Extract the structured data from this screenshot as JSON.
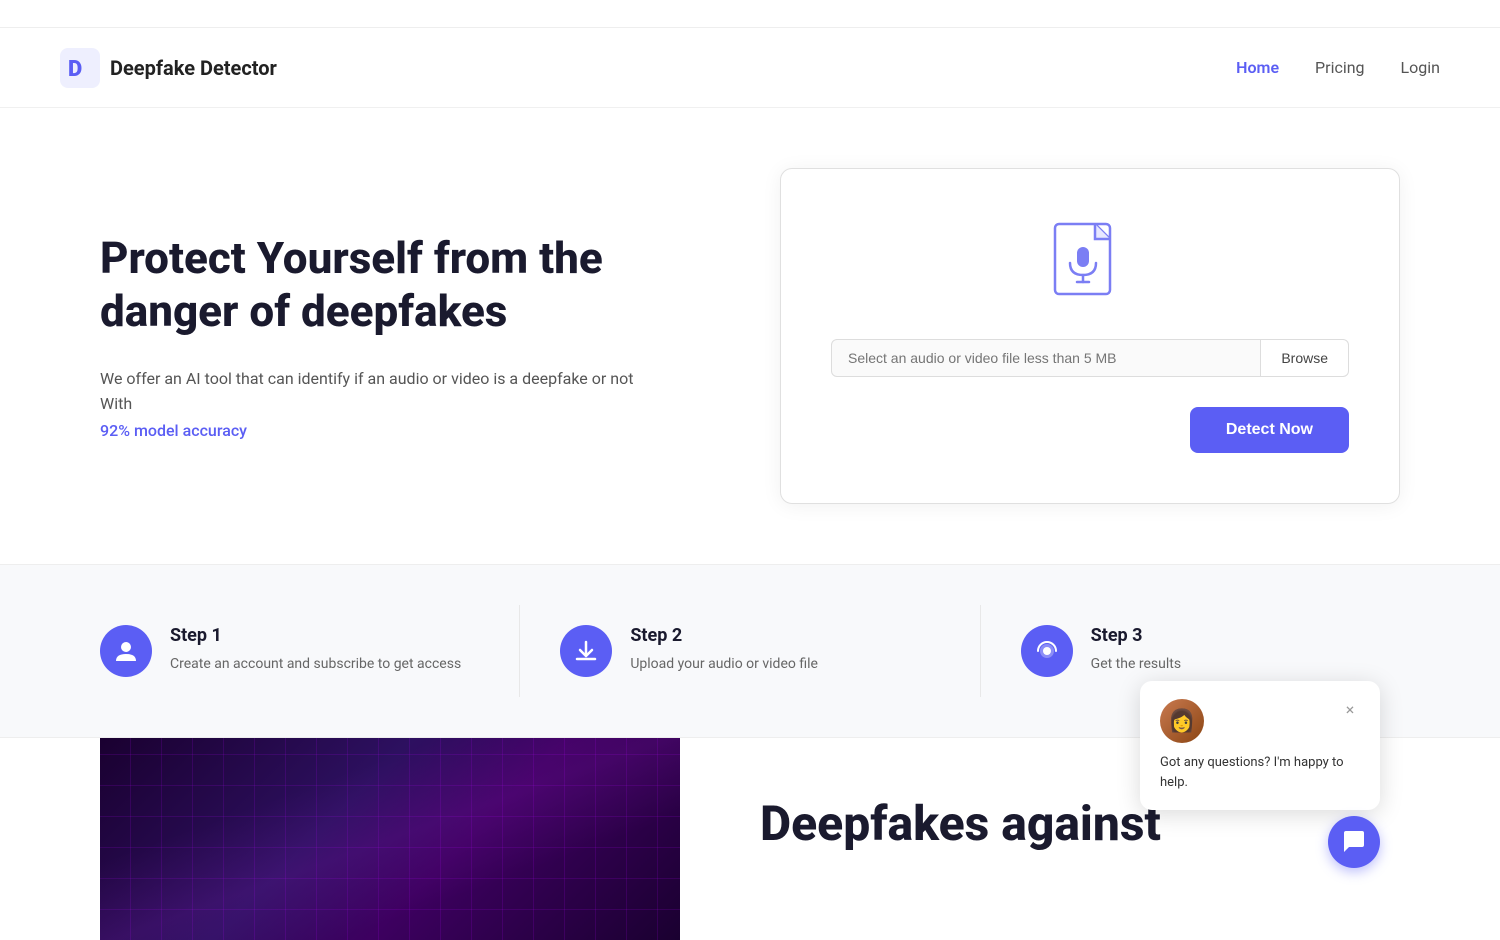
{
  "topbar": {},
  "navbar": {
    "logo_text": "Deepfake Detector",
    "links": [
      {
        "label": "Home",
        "id": "home",
        "active": true
      },
      {
        "label": "Pricing",
        "id": "pricing",
        "active": false
      },
      {
        "label": "Login",
        "id": "login",
        "active": false
      }
    ]
  },
  "hero": {
    "title": "Protect Yourself from the danger of deepfakes",
    "description": "We offer an AI tool that can identify if an audio or video is a deepfake or not With",
    "accuracy": "92% model accuracy"
  },
  "upload_card": {
    "file_input_placeholder": "Select an audio or video file less than 5 MB",
    "browse_label": "Browse",
    "detect_label": "Detect Now"
  },
  "steps": [
    {
      "id": "step1",
      "title": "Step 1",
      "description": "Create an account and subscribe to get access",
      "icon": "user"
    },
    {
      "id": "step2",
      "title": "Step 2",
      "description": "Upload your audio or video file",
      "icon": "download"
    },
    {
      "id": "step3",
      "title": "Step 3",
      "description": "Get the results",
      "icon": "speaker"
    }
  ],
  "bottom": {
    "title": "Deepfakes against"
  },
  "chat": {
    "message": "Got any questions? I'm happy to help.",
    "close_label": "×"
  },
  "colors": {
    "primary": "#5b5ef4",
    "text_dark": "#1a1a2e",
    "text_muted": "#555"
  }
}
